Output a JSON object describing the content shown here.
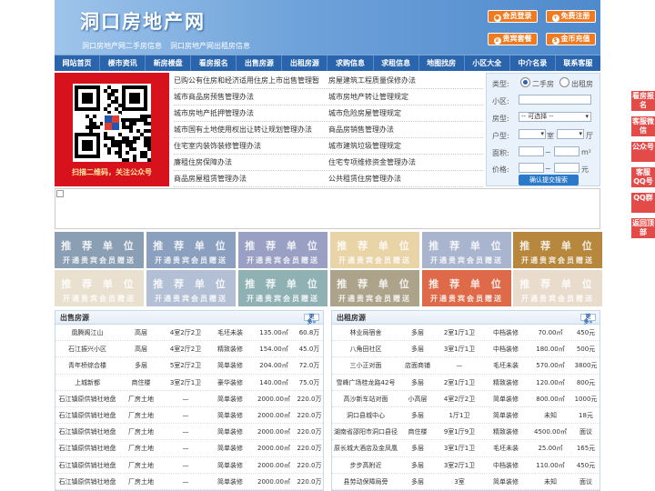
{
  "header": {
    "logo": "洞口房地产网",
    "sub1": "洞口房地产网二手房信息",
    "sub2": "洞口房地产网出租房信息",
    "buttons": [
      "会员登录",
      "免费注册",
      "贵宾套餐",
      "金币充值"
    ]
  },
  "nav": [
    "网站首页",
    "楼市资讯",
    "新房楼盘",
    "看房报名",
    "出售房源",
    "出租房源",
    "求购信息",
    "求租信息",
    "地图找房",
    "小区大全",
    "中介名录",
    "联系客服"
  ],
  "qr": {
    "caption": "扫描二维码，关注公众号"
  },
  "links": [
    [
      "已购公有住房和经济适用住房上市出售管理暂",
      "房屋建筑工程质量保修办法"
    ],
    [
      "城市商品房预售管理办法",
      "城市房地产转让管理规定"
    ],
    [
      "城市房地产抵押管理办法",
      "城市危险房屋管理规定"
    ],
    [
      "城市国有土地使用权出让转让规划管理办法",
      "商品房销售管理办法"
    ],
    [
      "住宅室内装饰装修管理办法",
      "城市建筑垃圾管理规定"
    ],
    [
      "廉租住房保障办法",
      "住宅专项维修资金管理办法"
    ],
    [
      "商品房屋租赁管理办法",
      "公共租赁住房管理办法"
    ]
  ],
  "search": {
    "type_label": "类型:",
    "type_opt1": "二手房",
    "type_opt2": "出租房",
    "xiaoqu_label": "小区:",
    "fangxing_label": "房型:",
    "fangxing_value": "-- 可选择 --",
    "huxing_label": "户型:",
    "shi": "室",
    "ting": "厅",
    "mianji_label": "面积:",
    "jiage_label": "价格:",
    "tilde": "~",
    "m2": "m²",
    "yuan": "元",
    "submit": "确认提交搜索"
  },
  "ads": {
    "line1": "推 荐 单 位",
    "line2": "开通贵宾会员赠送",
    "colors": [
      "#8a9fb3",
      "#8b9fbf",
      "#9a9fc4",
      "#e9d4a8",
      "#a9b4cf",
      "#b6873c",
      "#e9e0d0",
      "#b3bfd4",
      "#8fb1b3",
      "#aca38a",
      "#de6a4a",
      "#e9dccd"
    ]
  },
  "sale": {
    "title": "出售房源",
    "more": "更多»",
    "rows": [
      [
        "凰腾阁江山",
        "高层",
        "4室2厅2卫",
        "毛坯未装",
        "135.00㎡",
        "60.8万"
      ],
      [
        "石江振兴小区",
        "高层",
        "4室2厅2卫",
        "精致装修",
        "154.00㎡",
        "45.0万"
      ],
      [
        "青年桥综合楼",
        "多层",
        "5室2厅2卫",
        "简单装修",
        "204.00㎡",
        "72.0万"
      ],
      [
        "上城新都",
        "商住楼",
        "3室2厅1卫",
        "豪华装修",
        "140.00㎡",
        "75.0万"
      ],
      [
        "石江镇原供销社地盘",
        "厂房土地",
        "—",
        "简单装修",
        "2000.00㎡",
        "220.0万"
      ],
      [
        "石江镇原供销社地盘",
        "厂房土地",
        "—",
        "简单装修",
        "2000.00㎡",
        "220.0万"
      ],
      [
        "石江镇原供销社地盘",
        "厂房土地",
        "—",
        "简单装修",
        "2000.00㎡",
        "220.0万"
      ],
      [
        "石江镇原供销社地盘",
        "厂房土地",
        "—",
        "简单装修",
        "2000.00㎡",
        "220.0万"
      ],
      [
        "石江镇原供销社地盘",
        "厂房土地",
        "—",
        "简单装修",
        "2000.00㎡",
        "220.0万"
      ],
      [
        "石江镇原供销社地盘",
        "厂房土地",
        "—",
        "简单装修",
        "2000.00㎡",
        "220.0万"
      ]
    ]
  },
  "rent": {
    "title": "出租房源",
    "more": "更多»",
    "rows": [
      [
        "林业局宿舍",
        "多层",
        "2室1厅1卫",
        "中档装修",
        "70.00㎡",
        "450元"
      ],
      [
        "八角田社区",
        "多层",
        "3室1厅1卫",
        "中档装修",
        "180.00㎡",
        "500元"
      ],
      [
        "三小正对面",
        "店面商铺",
        "—",
        "毛坯未装",
        "570.00㎡",
        "3800元"
      ],
      [
        "雪峰广场桂龙路42号",
        "多层",
        "2室1厅1卫",
        "精致装修",
        "120.00㎡",
        "800元"
      ],
      [
        "高沙新车站对面",
        "小高层",
        "4室2厅2卫",
        "简单装修",
        "800.00㎡",
        "1000元"
      ],
      [
        "洞口县城中心",
        "多层",
        "1厅1卫",
        "简单装修",
        "未知",
        "18元"
      ],
      [
        "湖南省邵阳市洞口县径",
        "商住楼",
        "9室1厅9卫",
        "精致装修",
        "4500.00㎡",
        "面议"
      ],
      [
        "原长城大酒店及金凤凰",
        "多层",
        "3室1厅1卫",
        "毛坯未装",
        "25.00㎡",
        "165元"
      ],
      [
        "步步高附近",
        "多层",
        "3室2厅1卫",
        "中档装修",
        "110.00㎡",
        "450元"
      ],
      [
        "县劳动保障局旁",
        "多层",
        "3室",
        "简单装修",
        "未知",
        "面议"
      ]
    ]
  },
  "side": [
    "看房报名",
    "客服微信",
    "公众号",
    "客服QQ号",
    "QQ群",
    "返回顶部"
  ]
}
